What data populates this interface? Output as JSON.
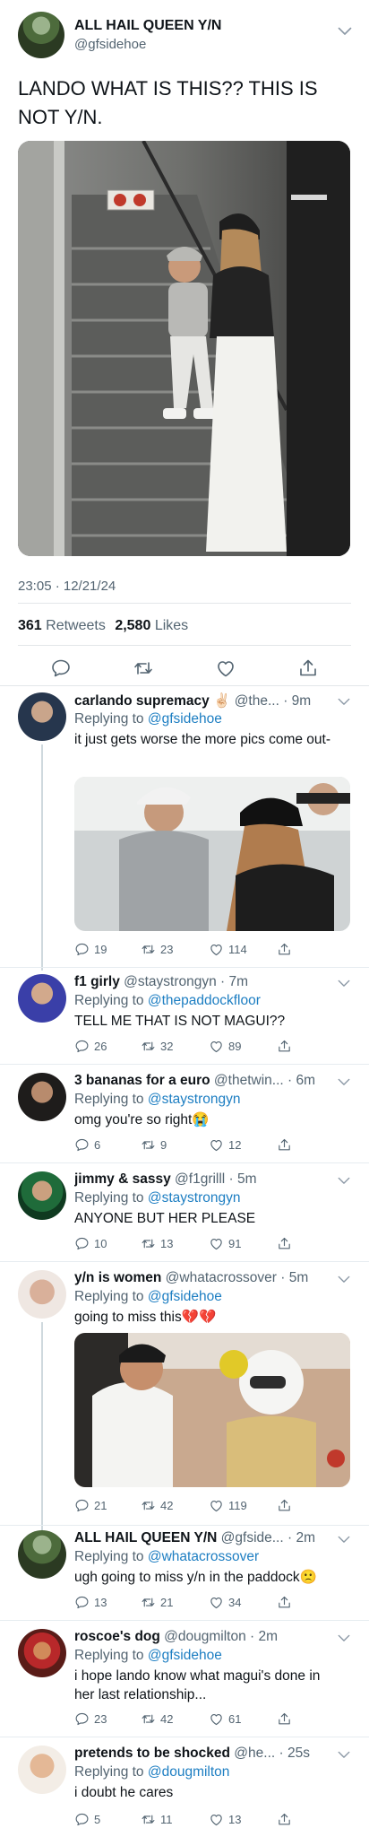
{
  "main_tweet": {
    "name": "ALL HAIL QUEEN Y/N",
    "handle": "@gfsidehoe",
    "text": "LANDO WHAT IS THIS?? THIS IS NOT Y/N.",
    "photo_sign_text": "NO ENTRY",
    "timestamp": "23:05 · 12/21/24",
    "retweets_count": "361",
    "retweets_label": "Retweets",
    "likes_count": "2,580",
    "likes_label": "Likes",
    "icons": [
      "reply-icon",
      "retweet-icon",
      "like-icon",
      "share-icon",
      "chevron-down-icon"
    ]
  },
  "replies": [
    {
      "name": "carlando supremacy ✌🏻",
      "meta": "@the... · 9m",
      "replying_prefix": "Replying to",
      "replying_to": "@gfsidehoe",
      "text": "it just gets worse the more pics come out-",
      "replies": "19",
      "retweets": "23",
      "likes": "114"
    },
    {
      "name": "f1 girly",
      "meta": "@staystrongyn · 7m",
      "replying_prefix": "Replying to",
      "replying_to": "@thepaddockfloor",
      "text": "TELL ME THAT IS NOT MAGUI??",
      "replies": "26",
      "retweets": "32",
      "likes": "89"
    },
    {
      "name": "3 bananas for a euro",
      "meta": "@thetwin... · 6m",
      "replying_prefix": "Replying to",
      "replying_to": "@staystrongyn",
      "text": "omg you're so right😭",
      "replies": "6",
      "retweets": "9",
      "likes": "12"
    },
    {
      "name": "jimmy & sassy",
      "meta": "@f1grilll · 5m",
      "replying_prefix": "Replying to",
      "replying_to": "@staystrongyn",
      "text": "ANYONE BUT HER PLEASE",
      "replies": "10",
      "retweets": "13",
      "likes": "91"
    },
    {
      "name": "y/n is women",
      "meta": "@whatacrossover · 5m",
      "replying_prefix": "Replying to",
      "replying_to": "@gfsidehoe",
      "text": "going to miss this💔💔",
      "replies": "21",
      "retweets": "42",
      "likes": "119"
    },
    {
      "name": "ALL HAIL QUEEN Y/N",
      "meta": "@gfside... · 2m",
      "replying_prefix": "Replying to",
      "replying_to": "@whatacrossover",
      "text": "ugh going to miss y/n in the paddock🙁",
      "replies": "13",
      "retweets": "21",
      "likes": "34"
    },
    {
      "name": "roscoe's dog",
      "meta": "@dougmilton · 2m",
      "replying_prefix": "Replying to",
      "replying_to": "@gfsidehoe",
      "text": "i hope lando know what magui's done in her last relationship...",
      "replies": "23",
      "retweets": "42",
      "likes": "61"
    },
    {
      "name": "pretends to be shocked",
      "meta": "@he... · 25s",
      "replying_prefix": "Replying to",
      "replying_to": "@dougmilton",
      "text": "i doubt he cares",
      "replies": "5",
      "retweets": "11",
      "likes": "13"
    }
  ],
  "colors": {
    "text": "#0f1419",
    "secondary": "#536471",
    "mention": "#1d7ec2",
    "divider": "#e3e6e9",
    "thread_line": "#cfd9de"
  }
}
